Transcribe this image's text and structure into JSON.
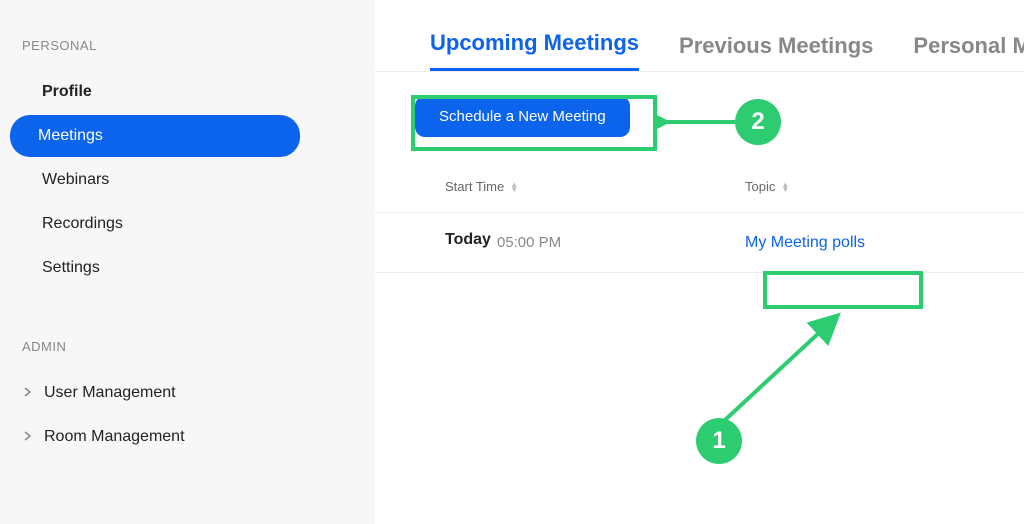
{
  "sidebar": {
    "section_personal": "PERSONAL",
    "section_admin": "ADMIN",
    "items": {
      "profile": "Profile",
      "meetings": "Meetings",
      "webinars": "Webinars",
      "recordings": "Recordings",
      "settings": "Settings",
      "user_mgmt": "User Management",
      "room_mgmt": "Room Management"
    }
  },
  "tabs": {
    "upcoming": "Upcoming Meetings",
    "previous": "Previous Meetings",
    "personal": "Personal Meeting Room"
  },
  "buttons": {
    "schedule": "Schedule a New Meeting"
  },
  "table": {
    "col_start": "Start Time",
    "col_topic": "Topic",
    "row1": {
      "day": "Today",
      "time": "05:00 PM",
      "topic": "My Meeting polls"
    }
  },
  "annotations": {
    "one": "1",
    "two": "2"
  }
}
